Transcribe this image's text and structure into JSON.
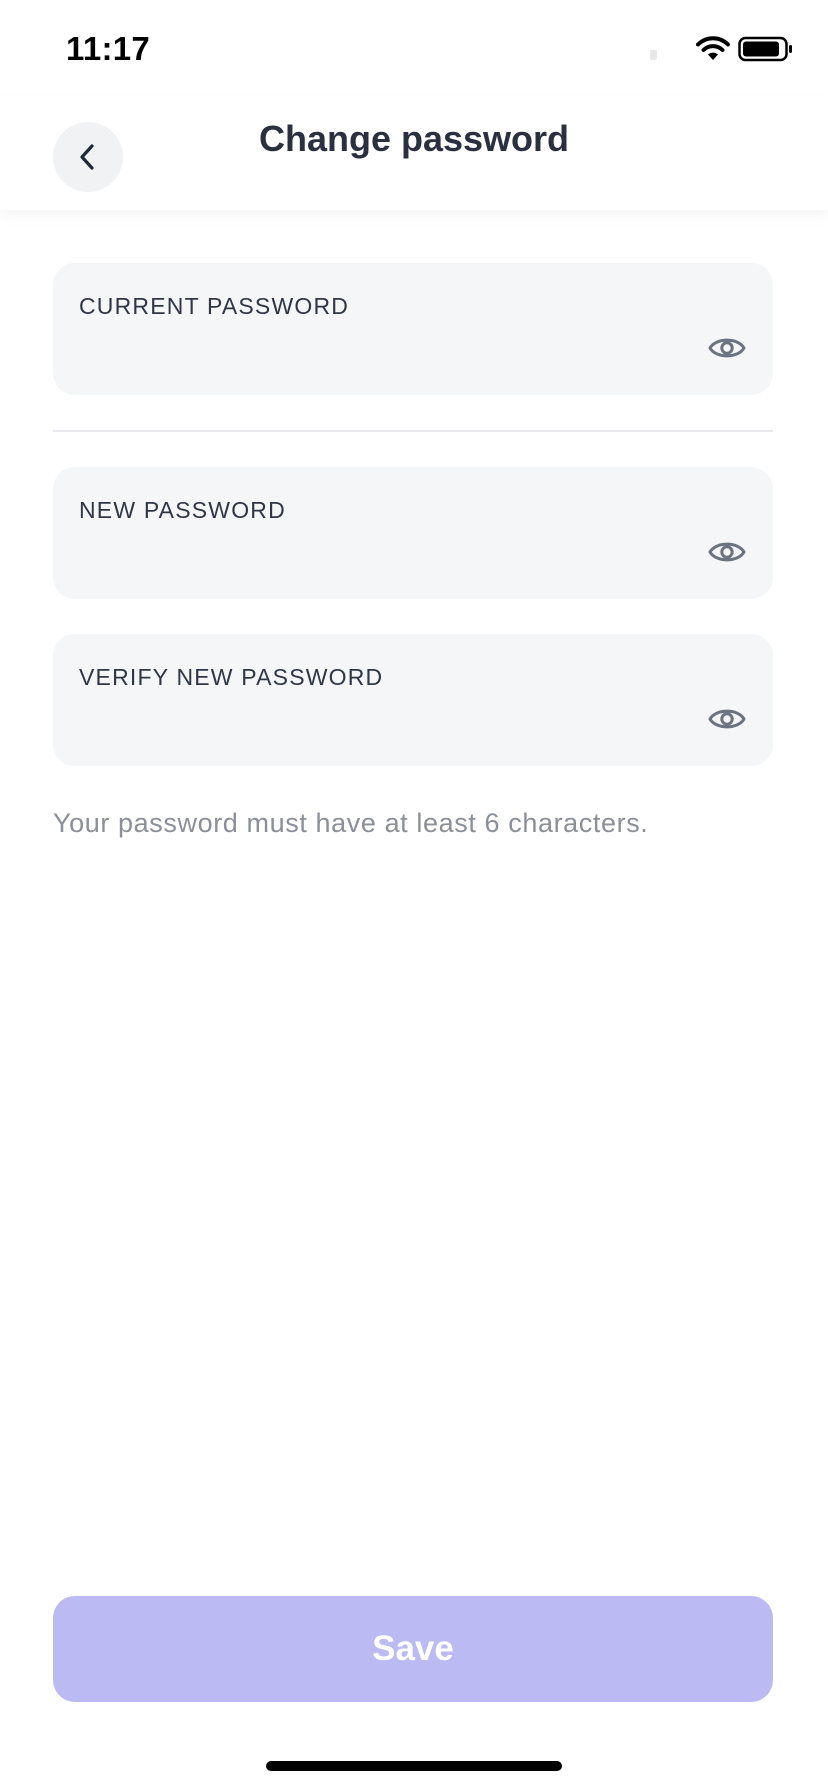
{
  "status_bar": {
    "time": "11:17"
  },
  "header": {
    "title": "Change password",
    "back_icon": "chevron-left-icon"
  },
  "form": {
    "fields": [
      {
        "label": "CURRENT PASSWORD",
        "value": "",
        "icon": "eye-icon"
      },
      {
        "label": "NEW PASSWORD",
        "value": "",
        "icon": "eye-icon"
      },
      {
        "label": "VERIFY NEW PASSWORD",
        "value": "",
        "icon": "eye-icon"
      }
    ],
    "hint": "Your password must have at least 6 characters."
  },
  "actions": {
    "save_label": "Save",
    "save_enabled": false
  },
  "colors": {
    "accent_disabled": "#bbbaf2",
    "field_background": "#f4f6f7",
    "title_text": "#2a3040",
    "hint_text": "#8a8f98"
  }
}
